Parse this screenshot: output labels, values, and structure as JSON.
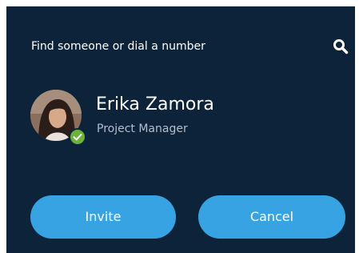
{
  "search": {
    "placeholder": "Find someone or dial a number",
    "icon": "search-icon"
  },
  "contact": {
    "name": "Erika Zamora",
    "title": "Project Manager",
    "presence": "available",
    "presence_color": "#6ab23a"
  },
  "buttons": {
    "invite_label": "Invite",
    "cancel_label": "Cancel"
  },
  "colors": {
    "background": "#0d2339",
    "button": "#37a3e3",
    "secondary_text": "#b3bfcc"
  }
}
